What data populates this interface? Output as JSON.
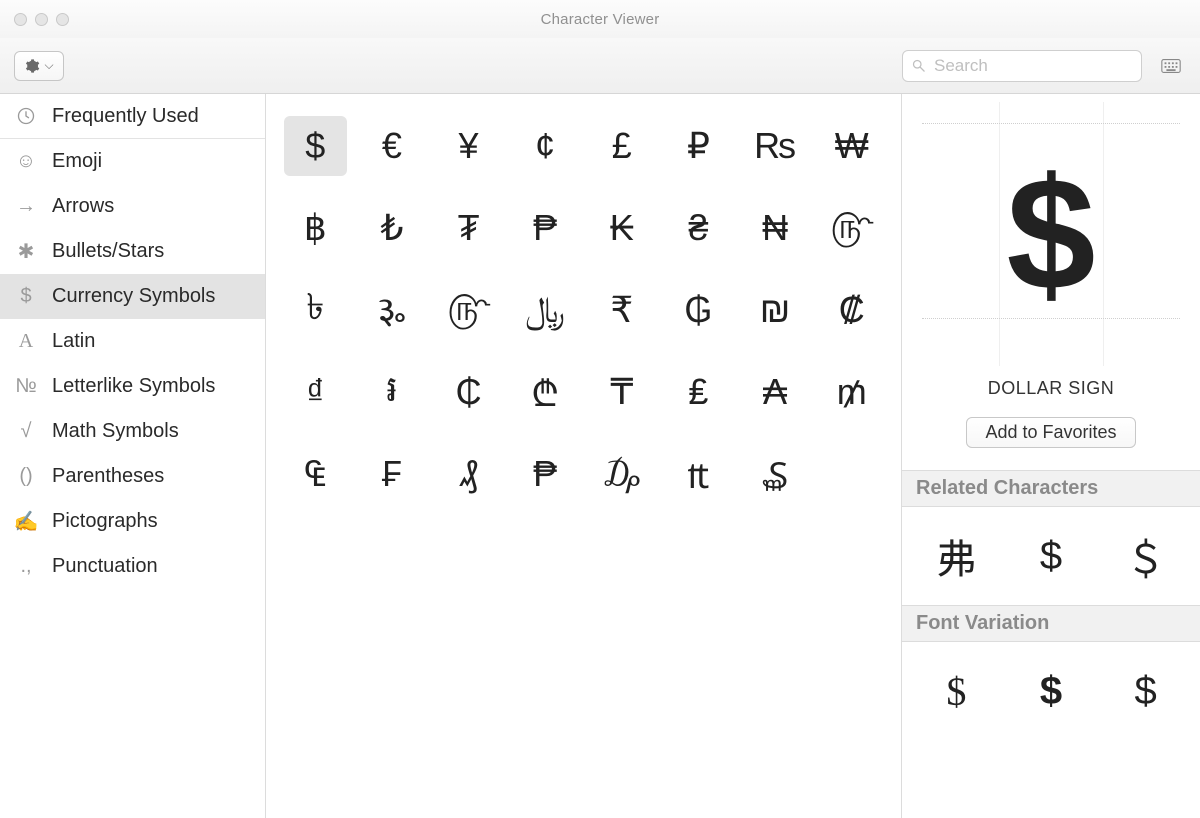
{
  "window": {
    "title": "Character Viewer"
  },
  "toolbar": {
    "search_placeholder": "Search"
  },
  "sidebar": {
    "frequently_used": "Frequently Used",
    "categories": [
      {
        "icon": "☺",
        "label": "Emoji"
      },
      {
        "icon": "→",
        "label": "Arrows"
      },
      {
        "icon": "✱",
        "label": "Bullets/Stars"
      },
      {
        "icon": "$",
        "label": "Currency Symbols",
        "selected": true
      },
      {
        "icon": "A",
        "label": "Latin"
      },
      {
        "icon": "№",
        "label": "Letterlike Symbols"
      },
      {
        "icon": "√",
        "label": "Math Symbols"
      },
      {
        "icon": "()",
        "label": "Parentheses"
      },
      {
        "icon": "✍",
        "label": "Pictographs"
      },
      {
        "icon": ".,",
        "label": "Punctuation"
      }
    ]
  },
  "grid": {
    "glyphs": [
      "$",
      "€",
      "¥",
      "¢",
      "£",
      "₽",
      "₨",
      "₩",
      "฿",
      "₺",
      "₮",
      "₱",
      "₭",
      "₴",
      "₦",
      "௹",
      "৳",
      "૱",
      "௹",
      "﷼",
      "₹",
      "₲",
      "₪",
      "₡",
      "₫",
      "៛",
      "₵",
      "₾",
      "₸",
      "₤",
      "₳",
      "₥",
      "₠",
      "₣",
      "₰",
      "₱",
      "₯",
      "₶",
      "₷",
      ""
    ],
    "selected_index": 0
  },
  "detail": {
    "glyph": "$",
    "name": "DOLLAR SIGN",
    "favorites_label": "Add to Favorites",
    "related_header": "Related Characters",
    "related": [
      "弗",
      "$",
      "＄"
    ],
    "variation_header": "Font Variation",
    "variations": [
      "$",
      "$",
      "$"
    ]
  }
}
